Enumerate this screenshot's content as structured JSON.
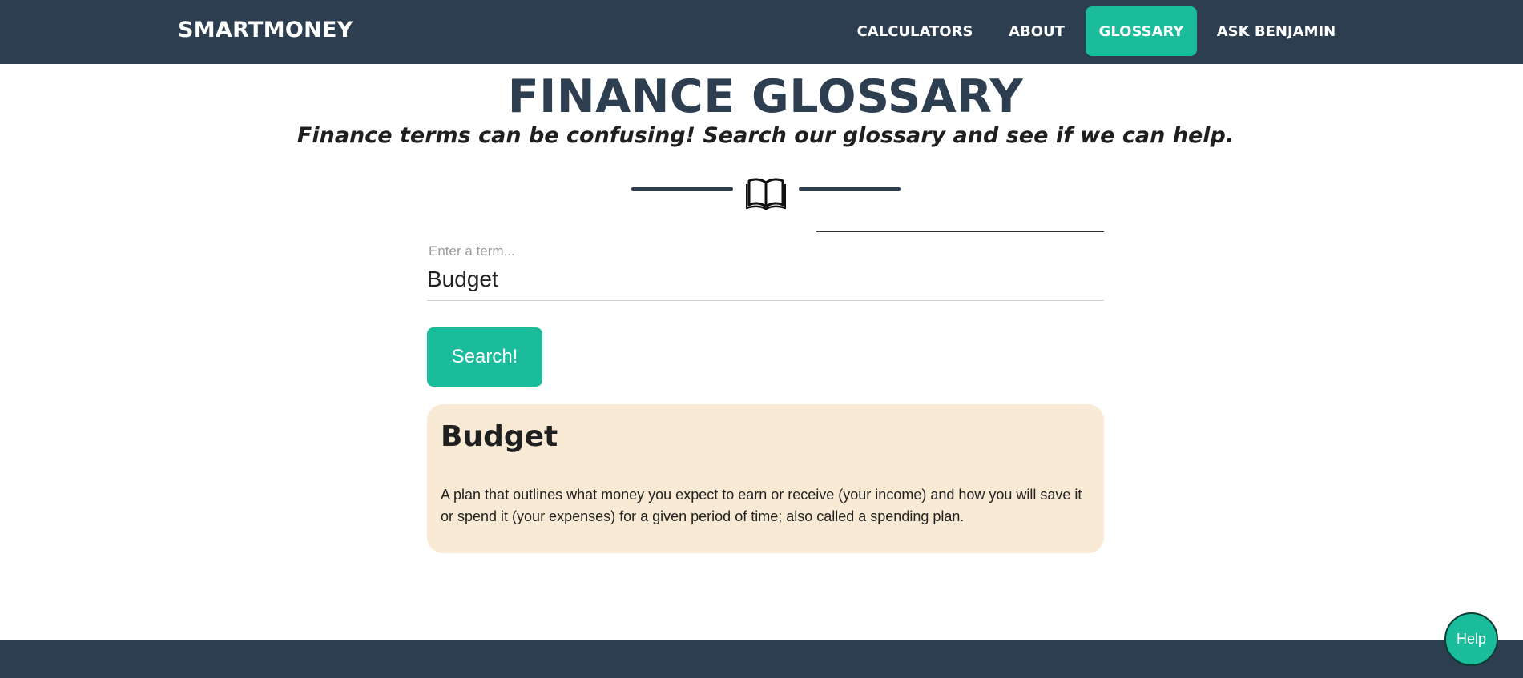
{
  "nav": {
    "brand": "SMARTMONEY",
    "items": [
      {
        "label": "CALCULATORS",
        "active": false
      },
      {
        "label": "ABOUT",
        "active": false
      },
      {
        "label": "GLOSSARY",
        "active": true
      },
      {
        "label": "ASK BENJAMIN",
        "active": false
      }
    ]
  },
  "header": {
    "title": "FINANCE GLOSSARY",
    "subtitle": "Finance terms can be confusing! Search our glossary and see if we can help.",
    "divider_icon": "open-book-icon"
  },
  "search": {
    "label": "Enter a term...",
    "value": "Budget",
    "button_label": "Search!"
  },
  "result": {
    "term": "Budget",
    "definition": "A plan that outlines what money you expect to earn or receive (your income) and how you will save it or spend it (your expenses) for a given period of time; also called a spending plan."
  },
  "help": {
    "label": "Help"
  },
  "colors": {
    "navbar": "#2c3e50",
    "accent": "#1abc9c",
    "card": "#f9ead5"
  }
}
